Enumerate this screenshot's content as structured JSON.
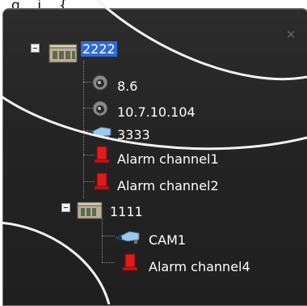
{
  "window": {
    "close_glyph": "×"
  },
  "tree": {
    "root": {
      "label": "2222",
      "icon": "server-rack-icon",
      "selected": true,
      "expanded": true
    },
    "children": [
      {
        "label": "8.6",
        "icon": "dome-camera-icon"
      },
      {
        "label": "10.7.10.104",
        "icon": "dome-camera-icon"
      },
      {
        "label": "3333",
        "icon": "bullet-camera-icon"
      },
      {
        "label": "Alarm channel1",
        "icon": "alarm-siren-icon"
      },
      {
        "label": "Alarm channel2",
        "icon": "alarm-siren-icon"
      }
    ],
    "subgroup": {
      "label": "1111",
      "icon": "server-rack-icon",
      "expanded": true,
      "children": [
        {
          "label": "CAM1",
          "icon": "bullet-camera-icon"
        },
        {
          "label": "Alarm channel4",
          "icon": "alarm-siren-icon"
        }
      ]
    }
  },
  "colors": {
    "panel_bg": "#262626",
    "selection": "#2f6bd8",
    "alarm_red": "#e01b1b",
    "camera_blue": "#9cc8ee"
  }
}
